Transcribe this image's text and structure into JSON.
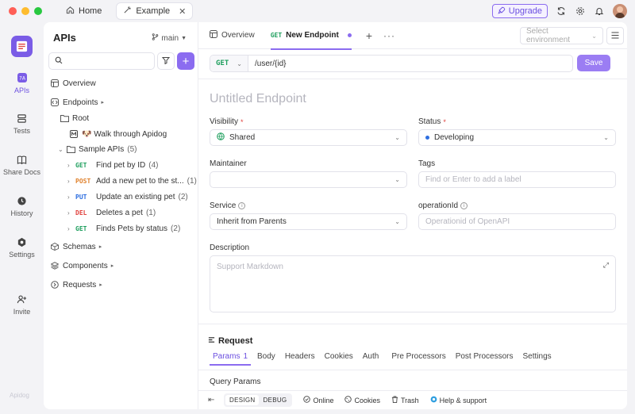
{
  "titlebar": {
    "tabs": [
      {
        "label": "Home"
      },
      {
        "label": "Example"
      }
    ],
    "upgrade_label": "Upgrade"
  },
  "leftnav": {
    "items": [
      {
        "label": "APIs",
        "icon": "apis-icon"
      },
      {
        "label": "Tests",
        "icon": "tests-icon"
      },
      {
        "label": "Share Docs",
        "icon": "book-icon"
      },
      {
        "label": "History",
        "icon": "clock-icon"
      },
      {
        "label": "Settings",
        "icon": "gear-icon"
      },
      {
        "label": "Invite",
        "icon": "user-plus-icon"
      }
    ],
    "brand": "Apidog"
  },
  "tree": {
    "title": "APIs",
    "branch": "main",
    "search_placeholder": "",
    "items": [
      {
        "label": "Overview"
      },
      {
        "label": "Endpoints"
      },
      {
        "label": "Root"
      },
      {
        "label": "🐶 Walk through Apidog"
      },
      {
        "label": "Sample APIs",
        "count": "(5)"
      },
      {
        "method": "GET",
        "label": "Find pet by ID",
        "count": "(4)"
      },
      {
        "method": "POST",
        "label": "Add a new pet to the st...",
        "count": "(1)"
      },
      {
        "method": "PUT",
        "label": "Update an existing pet",
        "count": "(2)"
      },
      {
        "method": "DEL",
        "label": "Deletes a pet",
        "count": "(1)"
      },
      {
        "method": "GET",
        "label": "Finds Pets by status",
        "count": "(2)"
      },
      {
        "label": "Schemas"
      },
      {
        "label": "Components"
      },
      {
        "label": "Requests"
      }
    ]
  },
  "main": {
    "tabs": {
      "overview": "Overview",
      "active_method": "GET",
      "active_label": "New Endpoint"
    },
    "env_placeholder": "Select environment",
    "method": "GET",
    "url": "/user/{id}",
    "save_label": "Save",
    "title_placeholder": "Untitled Endpoint",
    "fields": {
      "visibility_label": "Visibility",
      "visibility_value": "Shared",
      "status_label": "Status",
      "status_value": "Developing",
      "maintainer_label": "Maintainer",
      "tags_label": "Tags",
      "tags_placeholder": "Find or Enter to add a label",
      "service_label": "Service",
      "service_value": "Inherit from Parents",
      "operation_label": "operationId",
      "operation_placeholder": "Operationid of OpenAPI",
      "description_label": "Description",
      "description_placeholder": "Support Markdown"
    },
    "request": {
      "title": "Request",
      "tabs": [
        {
          "label": "Params",
          "badge": "1"
        },
        {
          "label": "Body"
        },
        {
          "label": "Headers"
        },
        {
          "label": "Cookies"
        },
        {
          "label": "Auth"
        },
        {
          "label": "Pre Processors"
        },
        {
          "label": "Post Processors"
        },
        {
          "label": "Settings"
        }
      ],
      "query_params": "Query Params"
    },
    "footer": {
      "design": "DESIGN",
      "debug": "DEBUG",
      "online": "Online",
      "cookies": "Cookies",
      "trash": "Trash",
      "help": "Help & support"
    }
  },
  "colors": {
    "accent": "#8b6cf0",
    "get": "#1f9f5e",
    "post": "#e0832f",
    "put": "#2f6fe0",
    "del": "#e0433f"
  }
}
